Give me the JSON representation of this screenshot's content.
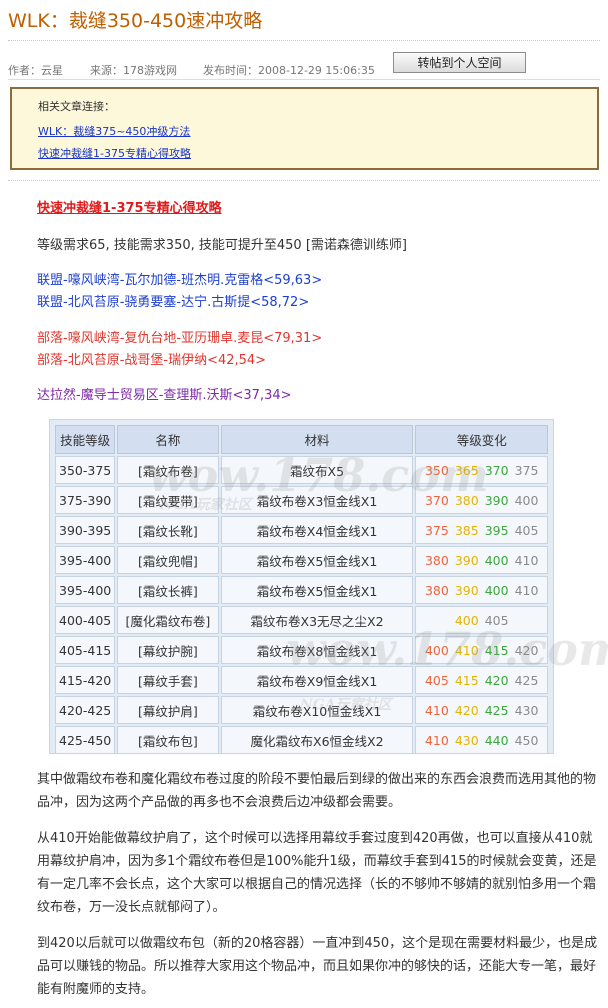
{
  "article": {
    "title": "WLK：裁缝350-450速冲攻略",
    "author": "作者：云星",
    "source": "来源：178游戏网",
    "published": "发布时间：2008-12-29 15:06:35",
    "repost_label": "转帖到个人空间"
  },
  "related": {
    "header": "相关文章连接：",
    "links": [
      "WLK：裁缝375~450冲级方法",
      "快速冲裁缝1-375专精心得攻略"
    ]
  },
  "body": {
    "heading": "快速冲裁缝1-375专精心得攻略",
    "requirement": "等级需求65, 技能需求350, 技能可提升至450 [需诺森德训练师]",
    "trainers": {
      "alliance": [
        "联盟-嚎风峡湾-瓦尔加德-班杰明.克雷格<59,63>",
        "联盟-北风苔原-骁勇要塞-达宁.古斯提<58,72>"
      ],
      "horde": [
        "部落-嚎风峡湾-复仇台地-亚历珊卓.麦昆<79,31>",
        "部落-北风苔原-战哥堡-瑞伊纳<42,54>"
      ],
      "neutral": [
        "达拉然-魔导士贸易区-查理斯.沃斯<37,34>"
      ]
    }
  },
  "table": {
    "headers": [
      "技能等级",
      "名称",
      "材料",
      "等级变化"
    ],
    "rows": [
      {
        "level": "350-375",
        "name": "[霜纹布卷]",
        "materials": "霜纹布X5",
        "change": [
          "350",
          "365",
          "370",
          "375"
        ]
      },
      {
        "level": "375-390",
        "name": "[霜纹要带]",
        "materials": "霜纹布卷X3恒金线X1",
        "change": [
          "370",
          "380",
          "390",
          "400"
        ]
      },
      {
        "level": "390-395",
        "name": "[霜纹长靴]",
        "materials": "霜纹布卷X4恒金线X1",
        "change": [
          "375",
          "385",
          "395",
          "405"
        ]
      },
      {
        "level": "395-400",
        "name": "[霜纹兜帽]",
        "materials": "霜纹布卷X5恒金线X1",
        "change": [
          "380",
          "390",
          "400",
          "410"
        ]
      },
      {
        "level": "395-400",
        "name": "[霜纹长裤]",
        "materials": "霜纹布卷X5恒金线X1",
        "change": [
          "380",
          "390",
          "400",
          "410"
        ]
      },
      {
        "level": "400-405",
        "name": "[魔化霜纹布卷]",
        "materials": "霜纹布卷X3无尽之尘X2",
        "change": [
          "",
          "400",
          "",
          "405"
        ]
      },
      {
        "level": "405-415",
        "name": "[幕纹护腕]",
        "materials": "霜纹布卷X8恒金线X1",
        "change": [
          "400",
          "410",
          "415",
          "420"
        ]
      },
      {
        "level": "415-420",
        "name": "[幕纹手套]",
        "materials": "霜纹布卷X9恒金线X1",
        "change": [
          "405",
          "415",
          "420",
          "425"
        ]
      },
      {
        "level": "420-425",
        "name": "[幕纹护肩]",
        "materials": "霜纹布卷X10恒金线X1",
        "change": [
          "410",
          "420",
          "425",
          "430"
        ]
      },
      {
        "level": "425-450",
        "name": "[霜纹布包]",
        "materials": "魔化霜纹布X6恒金线X2",
        "change": [
          "410",
          "430",
          "440",
          "450"
        ]
      }
    ],
    "change_colors": [
      "#f0643c",
      "#e6b400",
      "#3ca83c",
      "#8a8a8a"
    ]
  },
  "watermarks": [
    "wow.178.com",
    "NGA玩家社区",
    "wow.178.com",
    "NGA玩家社区"
  ],
  "paragraphs": [
    "其中做霜纹布卷和魔化霜纹布卷过度的阶段不要怕最后到绿的做出来的东西会浪费而选用其他的物品冲，因为这两个产品做的再多也不会浪费后边冲级都会需要。",
    "从410开始能做幕纹护肩了，这个时候可以选择用幕纹手套过度到420再做，也可以直接从410就用幕纹护肩冲，因为多1个霜纹布卷但是100%能升1级，而幕纹手套到415的时候就会变黄，还是有一定几率不会长点，这个大家可以根据自己的情况选择（长的不够帅不够婧的就别怕多用一个霜纹布卷，万一没长点就郁闷了）。",
    "到420以后就可以做霜纹布包（新的20格容器）一直冲到450，这个是现在需要材料最少，也是成品可以赚钱的物品。所以推荐大家用这个物品冲，而且如果你冲的够快的话，还能大专一笔，最好能有附魔师的支持。"
  ]
}
